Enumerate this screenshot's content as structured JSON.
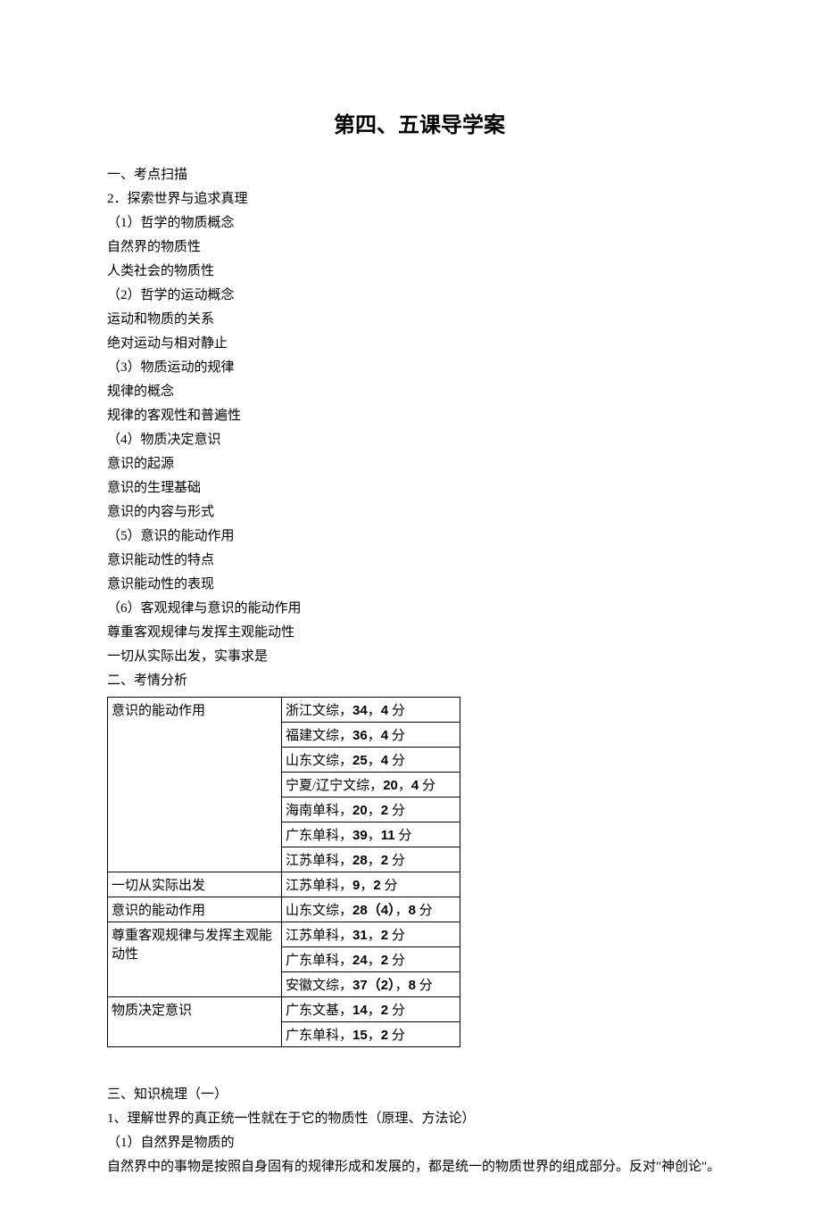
{
  "title": "第四、五课导学案",
  "section1_heading": "一、考点扫描",
  "outline": [
    "2．探索世界与追求真理",
    "（1）哲学的物质概念",
    "自然界的物质性",
    "人类社会的物质性",
    "（2）哲学的运动概念",
    "运动和物质的关系",
    "绝对运动与相对静止",
    "（3）物质运动的规律",
    "规律的概念",
    "规律的客观性和普遍性",
    "（4）物质决定意识",
    "意识的起源",
    "意识的生理基础",
    "意识的内容与形式",
    "（5）意识的能动作用",
    "意识能动性的特点",
    "意识能动性的表现",
    "（6）客观规律与意识的能动作用",
    "尊重客观规律与发挥主观能动性",
    "一切从实际出发，实事求是"
  ],
  "section2_heading": "二、考情分析",
  "table": {
    "groups": [
      {
        "topic": "意识的能动作用",
        "rows": [
          {
            "region": "浙江文综",
            "q": "34",
            "pts": "4"
          },
          {
            "region": "福建文综",
            "q": "36",
            "pts": "4"
          },
          {
            "region": "山东文综",
            "q": "25",
            "pts": "4"
          },
          {
            "region": "宁夏/辽宁文综",
            "q": "20",
            "pts": "4"
          },
          {
            "region": "海南单科",
            "q": "20",
            "pts": "2"
          },
          {
            "region": "广东单科",
            "q": "39",
            "pts": "11"
          },
          {
            "region": "江苏单科",
            "q": "28",
            "pts": "2"
          }
        ]
      },
      {
        "topic": "一切从实际出发",
        "rows": [
          {
            "region": "江苏单科",
            "q": "9",
            "pts": "2"
          }
        ]
      },
      {
        "topic": "意识的能动作用",
        "rows": [
          {
            "region": "山东文综",
            "q": "28（4）",
            "pts": "8"
          }
        ]
      },
      {
        "topic": "尊重客观规律与发挥主观能动性",
        "rows": [
          {
            "region": "江苏单科",
            "q": "31",
            "pts": "2"
          },
          {
            "region": "广东单科",
            "q": "24",
            "pts": "2"
          },
          {
            "region": "安徽文综",
            "q": "37（2）",
            "pts": "8"
          }
        ]
      },
      {
        "topic": "物质决定意识",
        "rows": [
          {
            "region": "广东文基",
            "q": "14",
            "pts": "2"
          },
          {
            "region": "广东单科",
            "q": "15",
            "pts": "2"
          }
        ]
      }
    ]
  },
  "section3_heading": "三、知识梳理（一）",
  "s3_lines": [
    "1、理解世界的真正统一性就在于它的物质性（原理、方法论）",
    "（1）自然界是物质的",
    "自然界中的事物是按照自身固有的规律形成和发展的，都是统一的物质世界的组成部分。反对\"神创论\"。"
  ]
}
